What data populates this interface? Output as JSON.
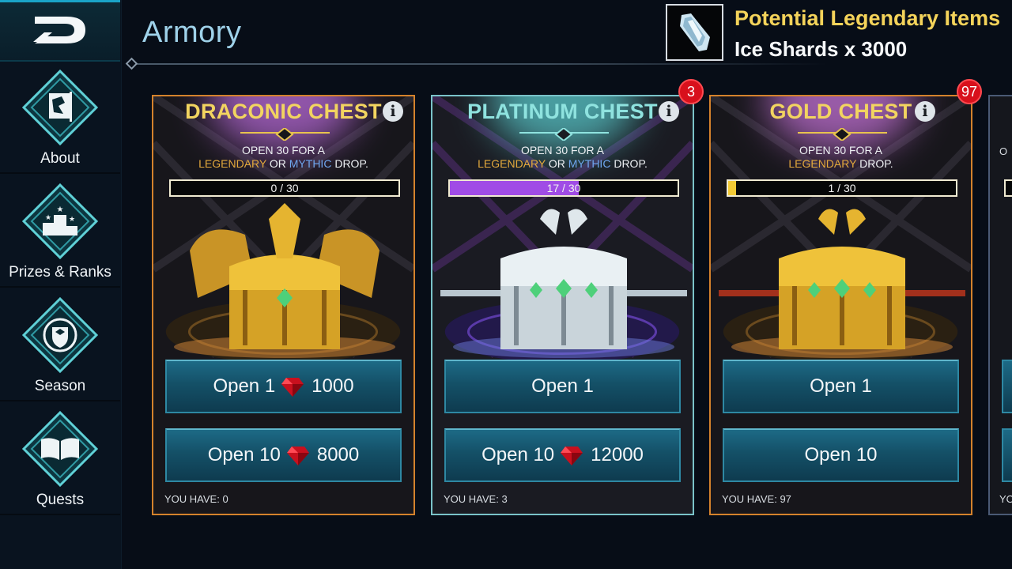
{
  "screen_title": "Armory",
  "sidebar": {
    "items": [
      {
        "label": "About",
        "icon": "dragon-banner-icon"
      },
      {
        "label": "Prizes & Ranks",
        "icon": "podium-stars-icon"
      },
      {
        "label": "Season",
        "icon": "laurel-shield-icon"
      },
      {
        "label": "Quests",
        "icon": "open-book-icon"
      }
    ]
  },
  "reward": {
    "title": "Potential Legendary Items",
    "amount": "Ice Shards x 3000",
    "icon": "ice-shard-icon"
  },
  "chests": [
    {
      "title": "DRACONIC CHEST",
      "title_color": "#f2d460",
      "subtitle_line1": "OPEN 30 FOR A",
      "rarity_1": "LEGENDARY",
      "connector": " OR ",
      "rarity_2": "MYTHIC",
      "subtitle_end": " DROP.",
      "progress_text": "0 / 30",
      "progress_fraction": 0.0,
      "progress_color": "#a04ce6",
      "open1_label": "Open 1",
      "open1_price": "1000",
      "open10_label": "Open 10",
      "open10_price": "8000",
      "you_have": "YOU HAVE: 0",
      "badge": ""
    },
    {
      "title": "PLATINUM CHEST",
      "title_color": "#8fe3df",
      "subtitle_line1": "OPEN 30 FOR A",
      "rarity_1": "LEGENDARY",
      "connector": " OR ",
      "rarity_2": "MYTHIC",
      "subtitle_end": " DROP.",
      "progress_text": "17 / 30",
      "progress_fraction": 0.567,
      "progress_color": "#a04ce6",
      "open1_label": "Open 1",
      "open1_price": "",
      "open10_label": "Open 10",
      "open10_price": "12000",
      "you_have": "YOU HAVE: 3",
      "badge": "3"
    },
    {
      "title": "GOLD CHEST",
      "title_color": "#f2d460",
      "subtitle_line1": "OPEN 30 FOR A",
      "rarity_1": "LEGENDARY",
      "connector": "",
      "rarity_2": "",
      "subtitle_end": " DROP.",
      "progress_text": "1 / 30",
      "progress_fraction": 0.0333,
      "progress_color": "#f2c935",
      "open1_label": "Open 1",
      "open1_price": "",
      "open10_label": "Open 10",
      "open10_price": "",
      "you_have": "YOU HAVE: 97",
      "badge": "97"
    }
  ],
  "partial_card": {
    "subtitle_fragment": "O",
    "you_have_fragment": "YO"
  },
  "colors": {
    "legendary": "#e3a93c",
    "mythic": "#6fa6ee",
    "badge": "#d8101c",
    "button": "#145067"
  }
}
